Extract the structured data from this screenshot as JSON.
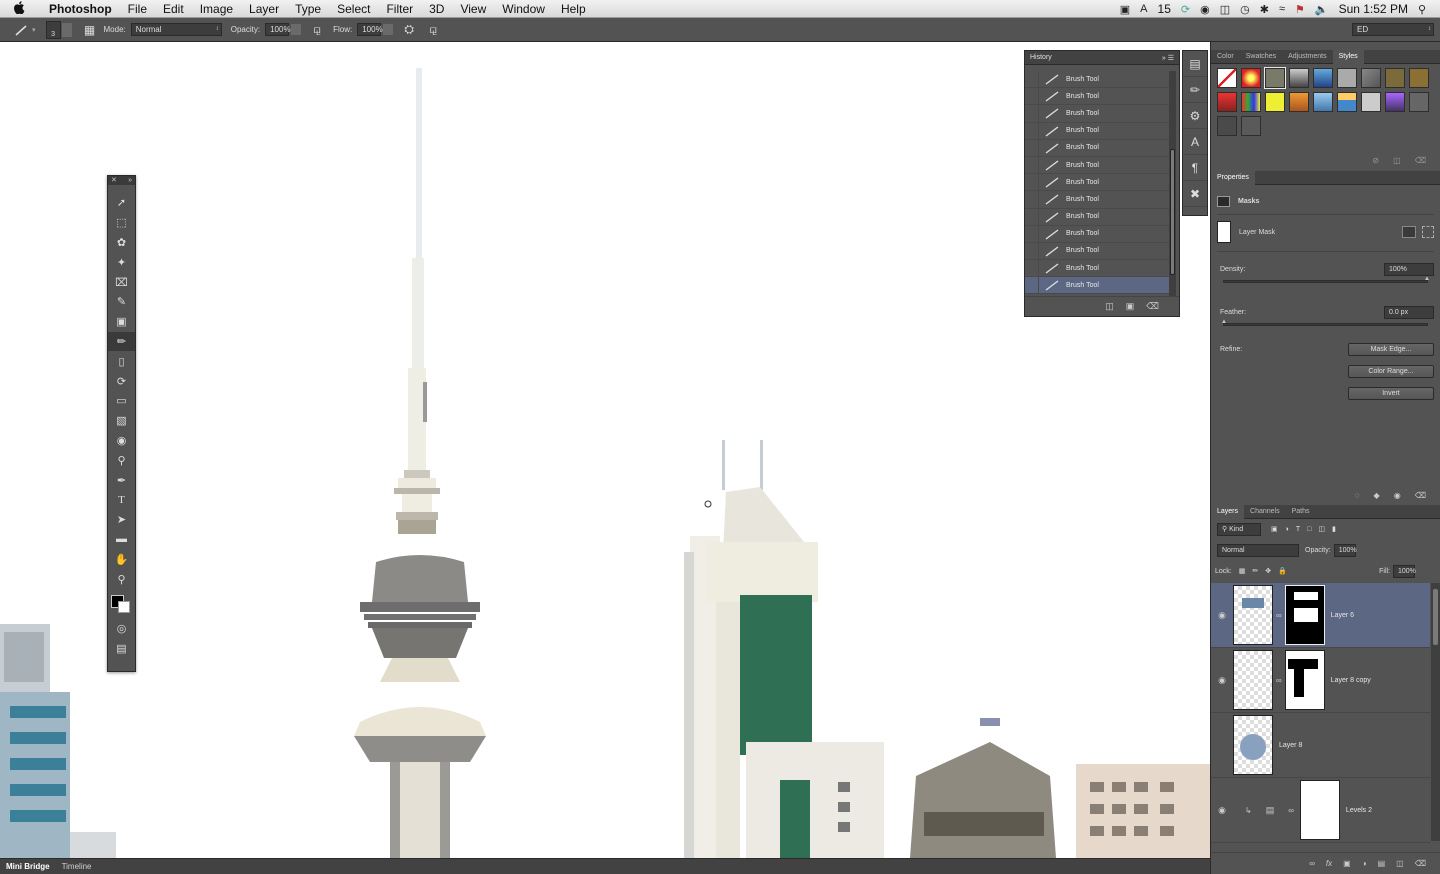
{
  "menubar": {
    "apple": "",
    "app_name": "Photoshop",
    "items": [
      "File",
      "Edit",
      "Image",
      "Layer",
      "Type",
      "Select",
      "Filter",
      "3D",
      "View",
      "Window",
      "Help"
    ],
    "status_number": "15",
    "clock": "Sun 1:52 PM"
  },
  "options": {
    "brush_size": "3",
    "mode_label": "Mode:",
    "mode_value": "Normal",
    "opacity_label": "Opacity:",
    "opacity_value": "100%",
    "flow_label": "Flow:",
    "flow_value": "100%",
    "workspace": "ED"
  },
  "history": {
    "title": "History",
    "items": [
      "Brush Tool",
      "Brush Tool",
      "Brush Tool",
      "Brush Tool",
      "Brush Tool",
      "Brush Tool",
      "Brush Tool",
      "Brush Tool",
      "Brush Tool",
      "Brush Tool",
      "Brush Tool",
      "Brush Tool",
      "Brush Tool"
    ]
  },
  "styles_panel": {
    "tabs": [
      "Color",
      "Swatches",
      "Adjustments",
      "Styles"
    ],
    "active_tab": "Styles"
  },
  "properties": {
    "title": "Properties",
    "section": "Masks",
    "mask_type": "Layer Mask",
    "density_label": "Density:",
    "density_value": "100%",
    "density_level": 1.0,
    "feather_label": "Feather:",
    "feather_value": "0.0 px",
    "feather_level": 0.0,
    "refine_label": "Refine:",
    "mask_edge_button": "Mask Edge...",
    "color_range_button": "Color Range...",
    "invert_button": "Invert"
  },
  "layers": {
    "tabs": [
      "Layers",
      "Channels",
      "Paths"
    ],
    "kind_label": "Kind",
    "blend_mode": "Normal",
    "opacity_label": "Opacity:",
    "opacity_value": "100%",
    "lock_label": "Lock:",
    "fill_label": "Fill:",
    "fill_value": "100%",
    "rows": [
      {
        "name": "Layer 6"
      },
      {
        "name": "Layer 8 copy"
      },
      {
        "name": "Layer 8"
      },
      {
        "name": "Levels 2"
      }
    ]
  },
  "statusbar": {
    "tabs": [
      "Mini Bridge",
      "Timeline"
    ]
  }
}
